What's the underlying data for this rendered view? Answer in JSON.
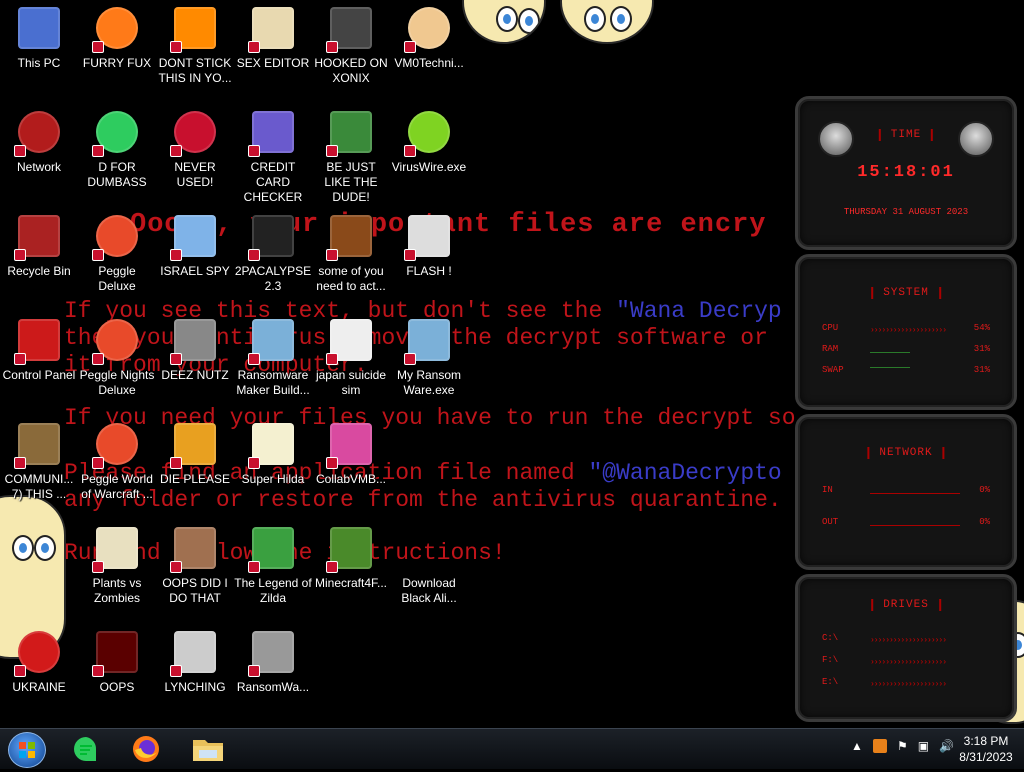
{
  "wallpaper": {
    "line1": "Ooops, your important files are encry",
    "line2a": "If you see this text, but don't see the ",
    "line2b": "\"Wana Decryp",
    "line3": "then your antivirus removed the decrypt software or",
    "line4": "it from your computer.",
    "line5": "If you need your files you have to run the decrypt so",
    "line6a": "Please find an application file named ",
    "line6b": "\"@WanaDecrypto",
    "line7": "any folder or restore from the antivirus quarantine.",
    "line8": "Run and follow the instructions!"
  },
  "icons": [
    {
      "label": "This PC",
      "icon": "computer-icon"
    },
    {
      "label": "FURRY FUX",
      "icon": "firefox-icon"
    },
    {
      "label": "DONT STICK THIS IN YO...",
      "icon": "vlc-cone-icon"
    },
    {
      "label": "SEX EDITOR",
      "icon": "hxd-editor-icon"
    },
    {
      "label": "HOOKED ON XONIX",
      "icon": "game-icon"
    },
    {
      "label": "VM0Techni...",
      "icon": "doctor-icon"
    },
    {
      "label": "Network",
      "icon": "network-icon"
    },
    {
      "label": "D FOR DUMBASS",
      "icon": "chat-bubble-icon"
    },
    {
      "label": "NEVER USED!",
      "icon": "dev-cpp-icon"
    },
    {
      "label": "CREDIT CARD CHECKER",
      "icon": "credit-card-icon"
    },
    {
      "label": "BE JUST LIKE THE DUDE!",
      "icon": "santa-icon"
    },
    {
      "label": "VirusWire.exe",
      "icon": "lime-icon"
    },
    {
      "label": "Recycle Bin",
      "icon": "recycle-bin-icon"
    },
    {
      "label": "Peggle Deluxe",
      "icon": "peggle-icon"
    },
    {
      "label": "ISRAEL SPY",
      "icon": "spy-screen-icon"
    },
    {
      "label": "2PACALYPSE 2.3",
      "icon": "terminal-icon"
    },
    {
      "label": "some of you need to act...",
      "icon": "dog-icon"
    },
    {
      "label": "FLASH !",
      "icon": "flash-icon"
    },
    {
      "label": "Control Panel",
      "icon": "control-panel-icon"
    },
    {
      "label": "Peggle Nights Deluxe",
      "icon": "peggle-icon"
    },
    {
      "label": "DEEZ NUTZ",
      "icon": "windows-stack-icon"
    },
    {
      "label": "Ransomware Maker Build...",
      "icon": "app-window-icon"
    },
    {
      "label": "japan suicide sim",
      "icon": "document-icon"
    },
    {
      "label": "My Ransom Ware.exe",
      "icon": "app-window-icon"
    },
    {
      "label": "COMMUNI... 7) THIS ...",
      "icon": "money-bag-icon"
    },
    {
      "label": "Peggle World of Warcraft ...",
      "icon": "peggle-icon"
    },
    {
      "label": "DIE PLEASE",
      "icon": "de-letters-icon"
    },
    {
      "label": "Super Hilda",
      "icon": "pixel-character-icon"
    },
    {
      "label": "CollabVMB...",
      "icon": "monitor-icon"
    },
    {
      "label": "",
      "icon": "blank-icon"
    },
    {
      "label": "",
      "icon": "blank-icon"
    },
    {
      "label": "Plants vs Zombies",
      "icon": "flower-icon"
    },
    {
      "label": "OOPS DID I DO THAT",
      "icon": "portrait-icon"
    },
    {
      "label": "The Legend of Zilda",
      "icon": "link-icon"
    },
    {
      "label": "Minecraft4F...",
      "icon": "grass-block-icon"
    },
    {
      "label": "Download Black Ali...",
      "icon": "blank-icon"
    },
    {
      "label": "UKRAINE",
      "icon": "radiation-icon"
    },
    {
      "label": "OOPS",
      "icon": "red-card-icon"
    },
    {
      "label": "LYNCHING",
      "icon": "angel-shield-icon"
    },
    {
      "label": "RansomWa...",
      "icon": "skull-icon"
    }
  ],
  "gadgets": {
    "time": {
      "title": "TIME",
      "clock": "15:18:01",
      "date": "THURSDAY 31 AUGUST 2023"
    },
    "system": {
      "title": "SYSTEM",
      "rows": [
        {
          "label": "CPU",
          "value": "54%"
        },
        {
          "label": "RAM",
          "value": "31%"
        },
        {
          "label": "SWAP",
          "value": "31%"
        }
      ]
    },
    "network": {
      "title": "NETWORK",
      "rows": [
        {
          "label": "IN",
          "value": "0%"
        },
        {
          "label": "OUT",
          "value": "0%"
        }
      ]
    },
    "drives": {
      "title": "DRIVES",
      "rows": [
        {
          "label": "C:\\",
          "value": ""
        },
        {
          "label": "F:\\",
          "value": ""
        },
        {
          "label": "E:\\",
          "value": ""
        }
      ]
    }
  },
  "taskbar": {
    "time": "3:18 PM",
    "date": "8/31/2023"
  },
  "colors": {
    "ransom_red": "#c0141a",
    "ransom_blue": "#3a3cc8",
    "gadget_red": "#e01a1a"
  }
}
